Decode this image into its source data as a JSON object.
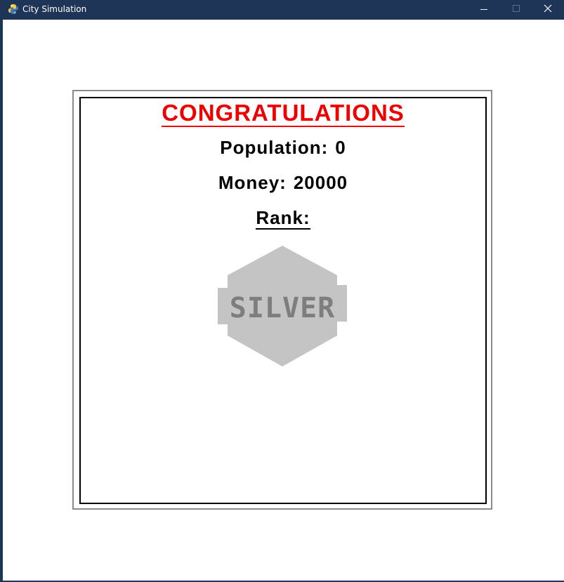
{
  "window": {
    "title": "City Simulation",
    "controls": [
      "minimize",
      "maximize",
      "close"
    ]
  },
  "results": {
    "heading": "CONGRATULATIONS",
    "population_label": "Population:",
    "population_value": "0",
    "money_label": "Money:",
    "money_value": "20000",
    "rank_label": "Rank:",
    "rank_badge": "SILVER"
  },
  "colors": {
    "titlebar": "#1f3558",
    "heading": "#ef0000",
    "badge_fill": "#c4c4c4",
    "badge_text": "#7e7e7e"
  }
}
